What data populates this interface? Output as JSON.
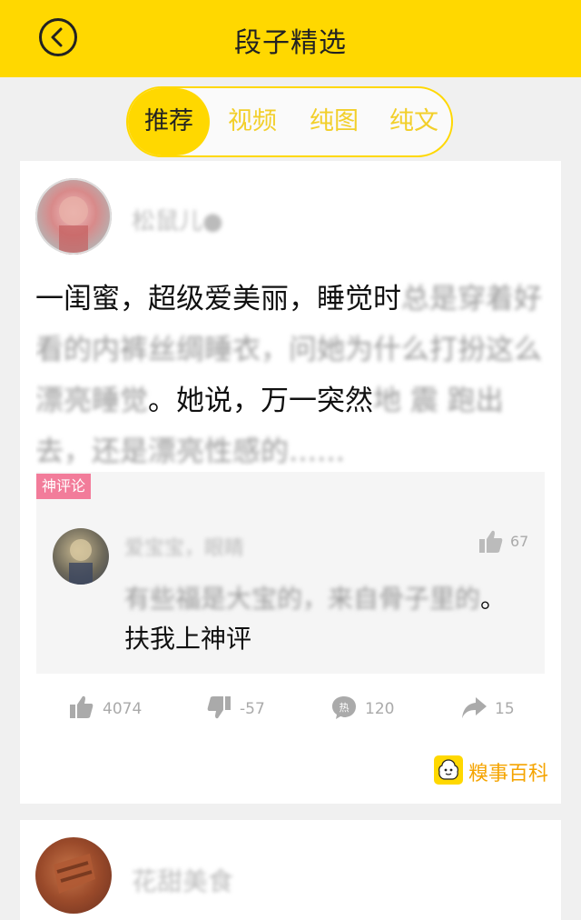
{
  "header": {
    "title": "段子精选",
    "back_icon": "chevron-left-icon"
  },
  "tabs": [
    {
      "label": "推荐",
      "active": true
    },
    {
      "label": "视频",
      "active": false
    },
    {
      "label": "纯图",
      "active": false
    },
    {
      "label": "纯文",
      "active": false
    }
  ],
  "post": {
    "username": "松鼠儿●",
    "text_parts": [
      "一闺蜜，超级爱美丽，睡觉时",
      "总是穿着好看的内裤丝绸睡衣，问她为什么打扮这么漂亮睡觉",
      "。她说，万一突然",
      "地 震 跑出去，还是漂亮性感的……"
    ],
    "god_comment": {
      "badge": "神评论",
      "commenter": "爱宝宝，眼睛",
      "likes": "67",
      "text_parts": [
        "有些福是大宝的，来自骨子里的",
        "。扶我上神评"
      ]
    },
    "stats": {
      "likes": "4074",
      "dislikes": "-57",
      "comments": "120",
      "shares": "15"
    },
    "source": "糗事百科"
  },
  "next_post": {
    "username": "花甜美食"
  },
  "colors": {
    "accent": "#ffd800",
    "badge": "#f27c9a",
    "source": "#f5a400"
  }
}
